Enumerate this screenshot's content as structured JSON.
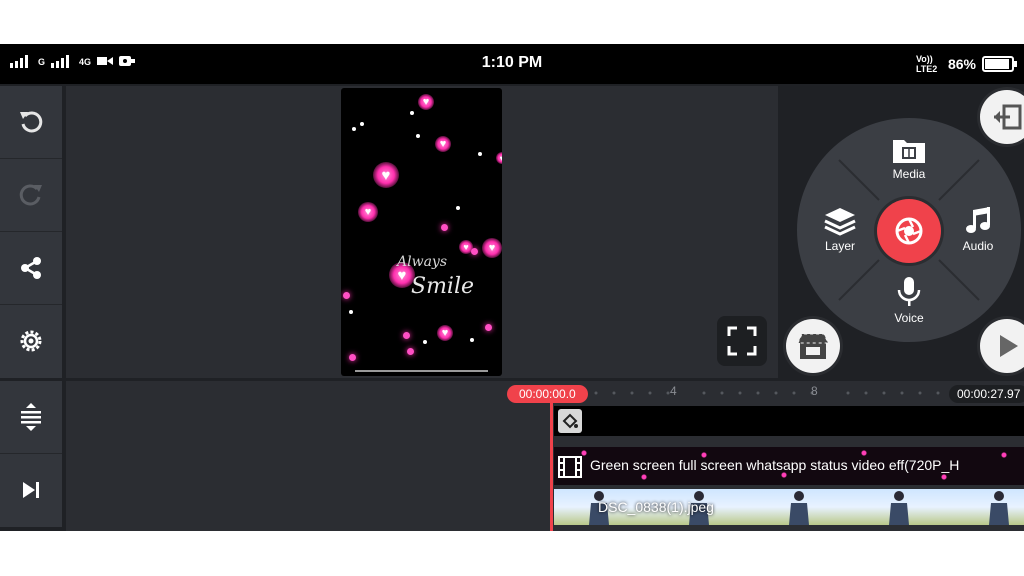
{
  "status_bar": {
    "time": "1:10 PM",
    "network_left_1": "G",
    "network_left_2": "4G",
    "lte_label": "Vo)) LTE2",
    "battery_percent": "86%",
    "battery_level": 0.86
  },
  "toolbar": {
    "undo": "undo-icon",
    "redo": "redo-icon",
    "share": "share-icon",
    "settings": "gear-icon",
    "timeline_expand": "expand-vertical-icon",
    "skip_to_end": "skip-to-end-icon"
  },
  "preview": {
    "text_line1": "Always",
    "text_line2": "Smile"
  },
  "menu": {
    "media": "Media",
    "layer": "Layer",
    "audio": "Audio",
    "voice": "Voice"
  },
  "timeline": {
    "current_time": "00:00:00.0",
    "total_time": "00:00:27.97",
    "ruler_marks": [
      "4",
      "8"
    ],
    "video_clip_title": "Green screen full screen whatsapp status video eff(720P_H",
    "image_clip_title": "DSC_0838(1).jpeg"
  },
  "colors": {
    "accent_red": "#f0424b",
    "panel_bg": "#1f2125",
    "toolbar_bg": "#33363c",
    "heart_pink": "#ff2fae"
  }
}
